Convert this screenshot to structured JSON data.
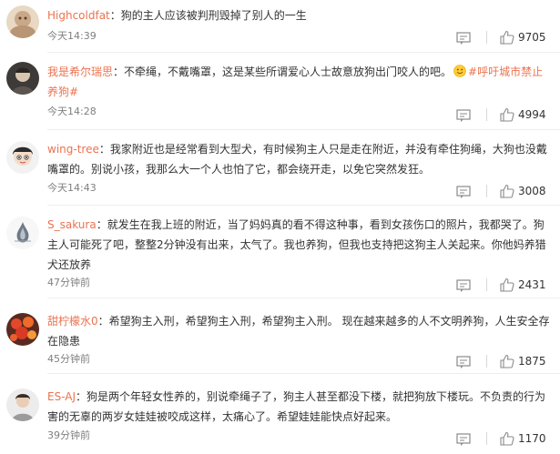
{
  "comments": [
    {
      "user": "Highcoldfat",
      "text": "：狗的主人应该被判刑毁掉了别人的一生",
      "time": "今天14:39",
      "likes": "9705"
    },
    {
      "user": "我是希尔瑞思",
      "text": "：不牵绳，不戴嘴罩，这是某些所谓爱心人士故意放狗出门咬人的吧。",
      "emoji_icon": "smile-emoji-icon",
      "topic": "#呼吁城市禁止养狗#",
      "time": "今天14:28",
      "likes": "4994"
    },
    {
      "user": "wing-tree",
      "text": "：我家附近也是经常看到大型犬，有时候狗主人只是走在附近，并没有牵住狗绳，大狗也没戴嘴罩的。别说小孩，我那么大一个人也怕了它，都会绕开走，以免它突然发狂。",
      "time": "今天14:43",
      "likes": "3008"
    },
    {
      "user": "S_sakura",
      "text": "：就发生在我上班的附近，当了妈妈真的看不得这种事，看到女孩伤口的照片，我都哭了。狗主人可能死了吧，整整2分钟没有出来，太气了。我也养狗，但我也支持把这狗主人关起来。你他妈养猎犬还放养",
      "time": "47分钟前",
      "likes": "2431"
    },
    {
      "user": "甜柠檬水0",
      "text": "：希望狗主入刑，希望狗主入刑，希望狗主入刑。 现在越来越多的人不文明养狗，人生安全存在隐患",
      "time": "45分钟前",
      "likes": "1875"
    },
    {
      "user": "ES-AJ",
      "text": "：狗是两个年轻女性养的，别说牵绳子了，狗主人甚至都没下楼，就把狗放下楼玩。不负责的行为害的无辜的两岁女娃娃被咬成这样，太痛心了。希望娃娃能快点好起来。",
      "time": "39分钟前",
      "likes": "1170"
    }
  ],
  "icons": {
    "reply": "reply-icon",
    "like": "thumbs-up-icon"
  },
  "colors": {
    "username": "#eb7350",
    "text": "#333333",
    "time": "#808080",
    "divider": "#eeeeee"
  }
}
